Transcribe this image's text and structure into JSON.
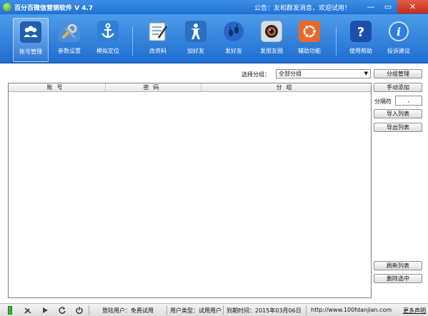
{
  "titlebar": {
    "title": "百分百微信营销软件  V 4.7",
    "notice": "公告：友和群发消息，欢迎试用！"
  },
  "toolbar": {
    "items": [
      {
        "label": "账号管理",
        "icon": "users-icon"
      },
      {
        "label": "参数设置",
        "icon": "wrench-icon"
      },
      {
        "label": "模拟定位",
        "icon": "anchor-icon"
      },
      {
        "label": "改资料",
        "icon": "edit-profile-icon"
      },
      {
        "label": "加好友",
        "icon": "add-friend-icon"
      },
      {
        "label": "发好友",
        "icon": "footprints-icon"
      },
      {
        "label": "发朋友圈",
        "icon": "camera-icon"
      },
      {
        "label": "辅助功能",
        "icon": "ubuntu-icon"
      },
      {
        "label": "使用帮助",
        "icon": "help-icon"
      },
      {
        "label": "投诉建议",
        "icon": "info-icon"
      }
    ]
  },
  "main": {
    "group_label": "选择分组：",
    "group_value": "全部分组",
    "columns": [
      "账号",
      "密码",
      "分组"
    ],
    "buttons": {
      "group_manage": "分组管理",
      "manual_add": "手动添加",
      "import_list": "导入列表",
      "export_list": "导出列表",
      "refresh_list": "刷新列表",
      "delete_selected": "删除选中"
    },
    "separator_label": "分隔符",
    "separator_value": ","
  },
  "statusbar": {
    "login_user": "登陆用户：免费试用",
    "user_type": "用户类型：试用用户",
    "expire": "到期时间：2015年03月06日",
    "url": "http://www.100fdanjian.com",
    "more": "更多声明"
  },
  "colors": {
    "toolbar_bg": "#2a7ad8",
    "close_button": "#c42b17",
    "status_online": "#34b534"
  }
}
